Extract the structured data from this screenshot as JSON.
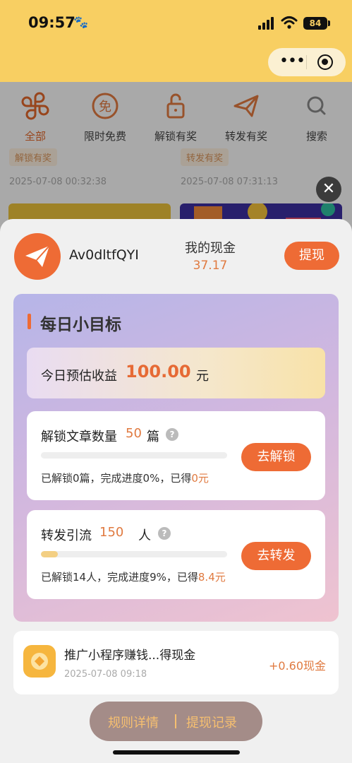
{
  "status_bar": {
    "time": "09:57",
    "battery": "84"
  },
  "categories": [
    {
      "label": "全部",
      "icon": "clover-icon",
      "active": true
    },
    {
      "label": "限时免费",
      "icon": "free-badge-icon",
      "active": false
    },
    {
      "label": "解锁有奖",
      "icon": "unlock-icon",
      "active": false
    },
    {
      "label": "转发有奖",
      "icon": "paper-plane-icon",
      "active": false
    },
    {
      "label": "搜索",
      "icon": "search-icon",
      "active": false
    }
  ],
  "background_feed": [
    {
      "tag": "解锁有奖",
      "date": "2025-07-08 00:32:38"
    },
    {
      "tag": "转发有奖",
      "date": "2025-07-08 07:31:13"
    }
  ],
  "close_label": "✕",
  "user": {
    "name": "Av0dltfQYI",
    "cash_label": "我的现金",
    "cash_value": "37.17",
    "withdraw_label": "提现"
  },
  "daily_goal": {
    "title": "每日小目标",
    "estimate": {
      "prefix": "今日预估收益",
      "amount": "100.00",
      "suffix": "元"
    },
    "tasks": [
      {
        "name": "解锁文章数量",
        "target": "50",
        "unit": "篇",
        "help": "?",
        "progress_percent": 0,
        "progress_text": "已解锁0篇，完成进度0%，已得",
        "earned": "0元",
        "button": "去解锁"
      },
      {
        "name": "转发引流",
        "target": "150",
        "unit": "人",
        "help": "?",
        "progress_percent": 9,
        "progress_text": "已解锁14人，完成进度9%，已得",
        "earned": "8.4元",
        "button": "去转发"
      }
    ]
  },
  "record": {
    "title": "推广小程序赚钱...得现金",
    "date": "2025-07-08 09:18",
    "amount": "+0.60现金"
  },
  "bottom_links": {
    "rules": "规则详情",
    "withdraw_records": "提现记录"
  },
  "colors": {
    "accent": "#ee6b35",
    "header": "#f8cf62",
    "amount": "#e07a40"
  }
}
